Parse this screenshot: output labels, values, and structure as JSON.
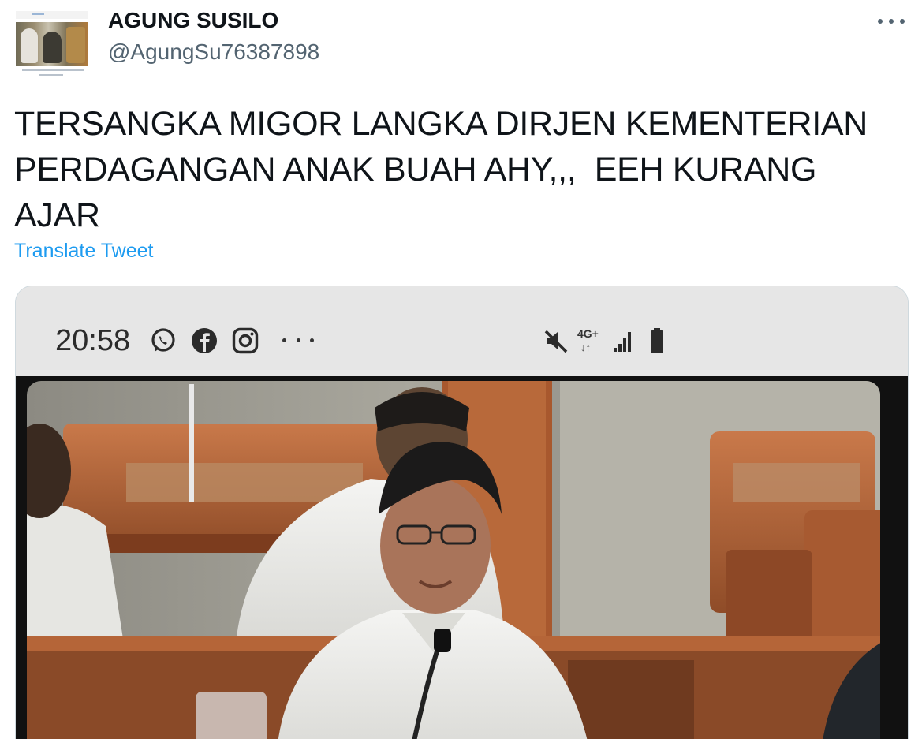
{
  "tweet": {
    "author_name": "AGUNG SUSILO",
    "author_handle": "@AgungSu76387898",
    "more_icon": "more-horizontal-icon",
    "text": "TERSANGKA MIGOR LANGKA DIRJEN KEMENTERIAN PERDAGANGAN ANAK BUAH AHY,,,  EEH KURANG AJAR",
    "translate_label": "Translate Tweet"
  },
  "media": {
    "status_bar": {
      "time": "20:58",
      "left_icons": [
        "whatsapp-icon",
        "facebook-icon",
        "instagram-icon",
        "more-dots-icon"
      ],
      "network_label": "4G+",
      "right_icons": [
        "mute-icon",
        "signal-icon",
        "battery-icon"
      ]
    },
    "photo_description_icon": "press-photo-image"
  },
  "colors": {
    "link": "#1d9bf0",
    "secondary_text": "#536471",
    "primary_text": "#0f1419",
    "border": "#cfd9de"
  }
}
